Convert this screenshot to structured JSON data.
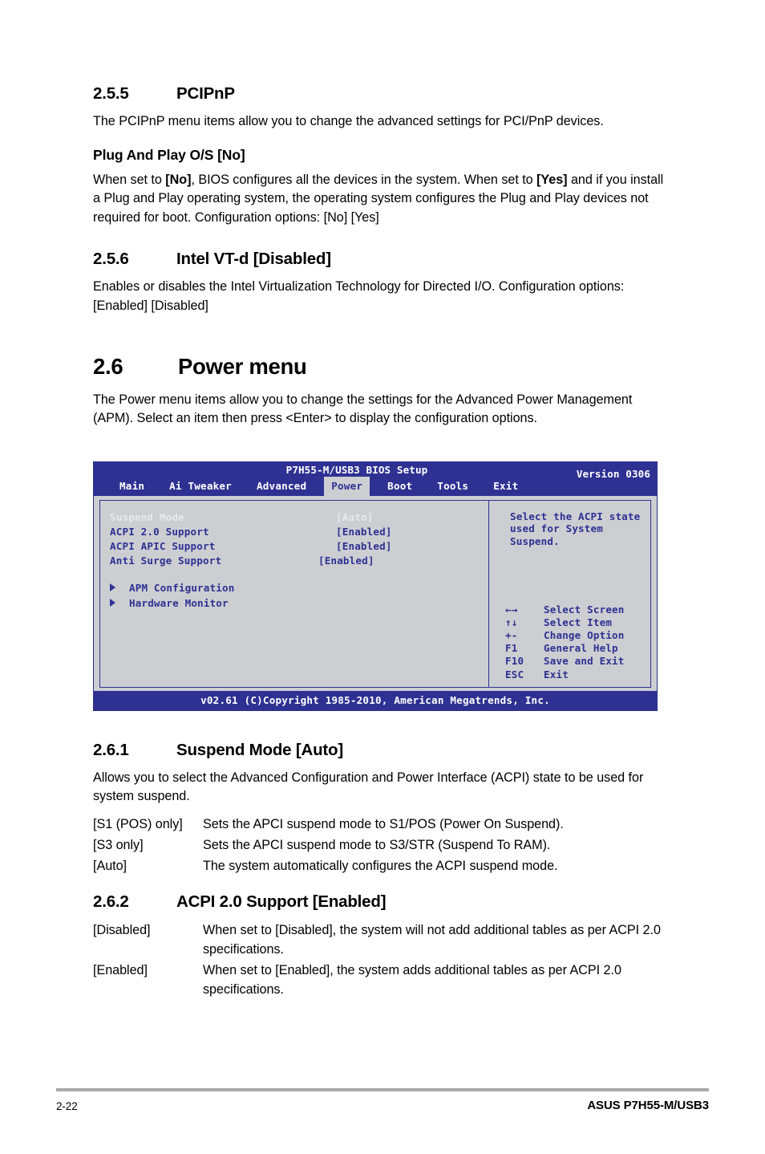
{
  "sections": {
    "s255": {
      "number": "2.5.5",
      "title": "PCIPnP",
      "intro": "The PCIPnP menu items allow you to change the advanced settings for PCI/PnP devices.",
      "subhead": "Plug And Play O/S [No]",
      "body_a": "When set to ",
      "body_b": "[No]",
      "body_c": ", BIOS configures all the devices in the system. When set to ",
      "body_d": "[Yes]",
      "body_e": " and if you install a Plug and Play operating system, the operating system configures the Plug and Play devices not required for boot. Configuration options: [No] [Yes]"
    },
    "s256": {
      "number": "2.5.6",
      "title": "Intel VT-d [Disabled]",
      "body": "Enables or disables the Intel Virtualization Technology for Directed I/O. Configuration options: [Enabled] [Disabled]"
    },
    "s26": {
      "number": "2.6",
      "title": "Power menu",
      "body": "The Power menu items allow you to change the settings for the Advanced Power Management (APM). Select an item then press <Enter> to display the configuration options."
    },
    "s261": {
      "number": "2.6.1",
      "title": "Suspend Mode [Auto]",
      "body": "Allows you to select the Advanced Configuration and Power Interface (ACPI) state to be used for system suspend.",
      "defs": [
        {
          "term": "[S1 (POS) only]",
          "desc": "Sets the APCI suspend mode to S1/POS (Power On Suspend)."
        },
        {
          "term": "[S3 only]",
          "desc": "Sets the APCI suspend mode to S3/STR (Suspend To RAM)."
        },
        {
          "term": "[Auto]",
          "desc": "The system automatically configures the ACPI suspend mode."
        }
      ]
    },
    "s262": {
      "number": "2.6.2",
      "title": "ACPI 2.0 Support [Enabled]",
      "defs": [
        {
          "term": "[Disabled]",
          "desc": "When set to [Disabled], the system will not add additional tables as per ACPI 2.0 specifications."
        },
        {
          "term": "[Enabled]",
          "desc": "When set to [Enabled], the system adds additional tables as per ACPI 2.0 specifications."
        }
      ]
    }
  },
  "bios": {
    "title": "P7H55-M/USB3 BIOS Setup",
    "version": "Version 0306",
    "tabs": [
      {
        "label": "Main",
        "active": false
      },
      {
        "label": "Ai Tweaker",
        "active": false
      },
      {
        "label": "Advanced",
        "active": false
      },
      {
        "label": "Power",
        "active": true
      },
      {
        "label": "Boot",
        "active": false
      },
      {
        "label": "Tools",
        "active": false
      },
      {
        "label": "Exit",
        "active": false
      }
    ],
    "options": [
      {
        "label": "Suspend Mode",
        "value": "[Auto]",
        "highlight": true,
        "shift": false
      },
      {
        "label": "ACPI 2.0 Support",
        "value": "[Enabled]",
        "highlight": false,
        "shift": false
      },
      {
        "label": "ACPI APIC Support",
        "value": "[Enabled]",
        "highlight": false,
        "shift": false
      },
      {
        "label": "Anti Surge Support",
        "value": "[Enabled]",
        "highlight": false,
        "shift": true
      }
    ],
    "submenus": [
      {
        "label": "APM Configuration"
      },
      {
        "label": "Hardware Monitor"
      }
    ],
    "help": [
      "Select the ACPI state",
      "used for System",
      "Suspend."
    ],
    "keys": [
      {
        "key": "←→",
        "action": "Select Screen"
      },
      {
        "key": "↑↓",
        "action": "Select Item"
      },
      {
        "key": "+-",
        "action": "Change Option"
      },
      {
        "key": "F1",
        "action": "General Help"
      },
      {
        "key": "F10",
        "action": "Save and Exit"
      },
      {
        "key": "ESC",
        "action": "Exit"
      }
    ],
    "footer": "v02.61 (C)Copyright 1985-2010, American Megatrends, Inc.",
    "colors": {
      "header_blue": "#2e3192",
      "panel_gray": "#cdced2",
      "highlight_text": "#e7e8ea"
    }
  },
  "page_footer": {
    "page_number": "2-22",
    "product": "ASUS P7H55-M/USB3"
  }
}
